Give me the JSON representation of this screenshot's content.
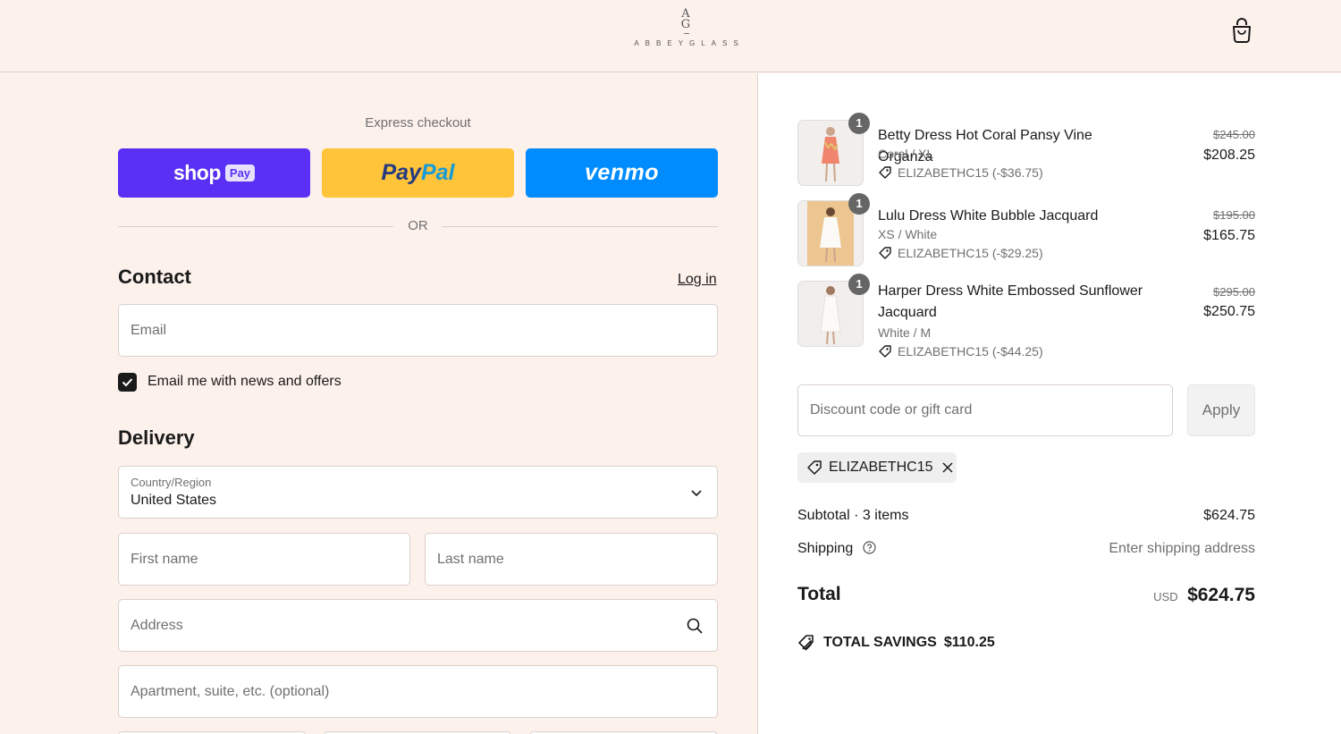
{
  "header": {
    "logo_monogram_top": "A",
    "logo_monogram_bottom": "G",
    "logo_wordmark": "ABBEYGLASS"
  },
  "express": {
    "title": "Express checkout",
    "shop_label": "shop",
    "shop_badge": "Pay",
    "paypal_pay": "Pay",
    "paypal_pal": "Pal",
    "venmo_label": "venmo",
    "or_label": "OR"
  },
  "contact": {
    "title": "Contact",
    "login_label": "Log in",
    "email_placeholder": "Email",
    "newsletter_label": "Email me with news and offers",
    "newsletter_checked": true
  },
  "delivery": {
    "title": "Delivery",
    "country_label": "Country/Region",
    "country_value": "United States",
    "first_name_placeholder": "First name",
    "last_name_placeholder": "Last name",
    "address_placeholder": "Address",
    "apartment_placeholder": "Apartment, suite, etc. (optional)"
  },
  "cart": {
    "items": [
      {
        "qty": "1",
        "name": "Betty Dress Hot Coral Pansy Vine Organza",
        "variant": "Coral / XL",
        "discount": "ELIZABETHC15 (-$36.75)",
        "original_price": "$245.00",
        "price": "$208.25"
      },
      {
        "qty": "1",
        "name": "Lulu Dress White Bubble Jacquard",
        "variant": "XS / White",
        "discount": "ELIZABETHC15 (-$29.25)",
        "original_price": "$195.00",
        "price": "$165.75"
      },
      {
        "qty": "1",
        "name": "Harper Dress White Embossed Sunflower Jacquard",
        "variant": "White / M",
        "discount": "ELIZABETHC15 (-$44.25)",
        "original_price": "$295.00",
        "price": "$250.75"
      }
    ],
    "discount_placeholder": "Discount code or gift card",
    "apply_label": "Apply",
    "applied_code": "ELIZABETHC15",
    "subtotal_label": "Subtotal · 3 items",
    "subtotal_value": "$624.75",
    "shipping_label": "Shipping",
    "shipping_value": "Enter shipping address",
    "total_label": "Total",
    "total_currency": "USD",
    "total_value": "$624.75",
    "savings_label": "TOTAL SAVINGS",
    "savings_value": "$110.25"
  },
  "colors": {
    "page_bg": "#fdf1ec",
    "shop_pay": "#5a31f4",
    "paypal": "#ffc439",
    "venmo": "#008cff"
  }
}
